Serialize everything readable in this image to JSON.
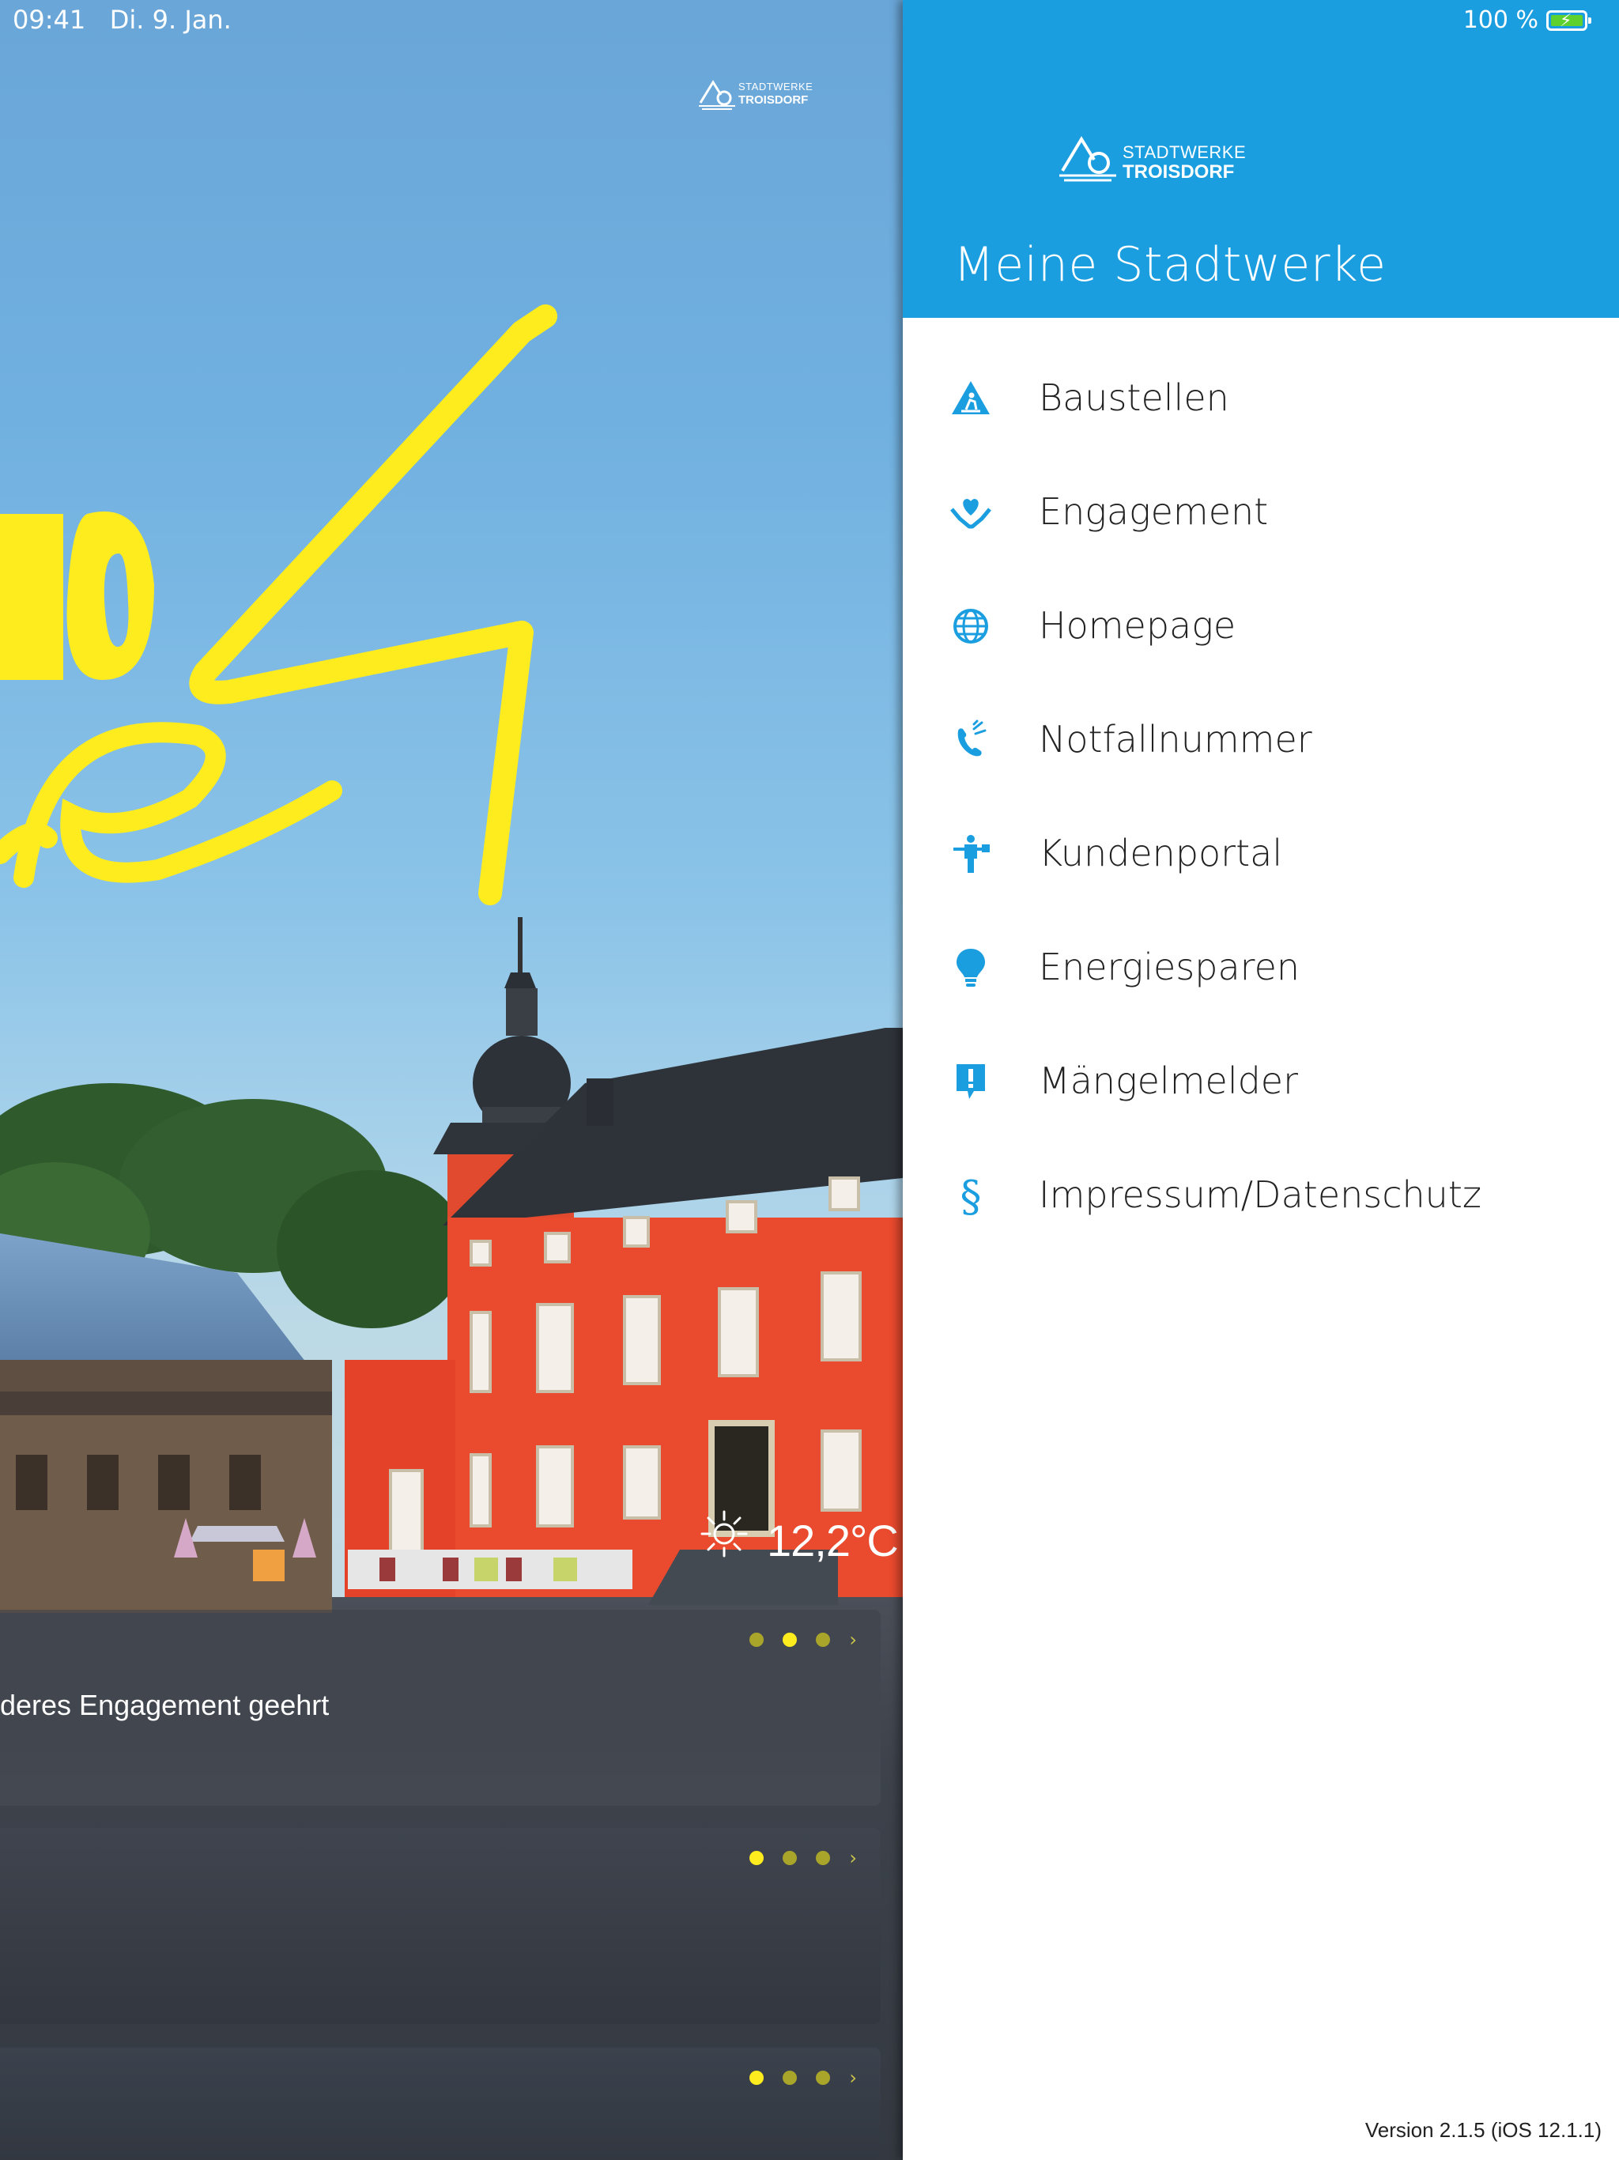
{
  "status_bar": {
    "time": "09:41",
    "date": "Di. 9. Jan.",
    "battery": "100 %"
  },
  "background": {
    "logo_line1": "STADTWERKE",
    "logo_line2": "TROISDORF",
    "weather": {
      "icon": "sun-icon",
      "temperature": "12,2°C"
    },
    "news_cards": [
      {
        "title": "deres Engagement geehrt",
        "dots": 3,
        "active_dot": 1
      },
      {
        "title": "",
        "dots": 3,
        "active_dot": 0
      },
      {
        "title": "",
        "dots": 3,
        "active_dot": 0
      }
    ]
  },
  "drawer": {
    "logo_line1": "STADTWERKE",
    "logo_line2": "TROISDORF",
    "title": "Meine Stadtwerke",
    "items": [
      {
        "label": "Baustellen",
        "icon": "construction-warning-icon"
      },
      {
        "label": "Engagement",
        "icon": "heart-hands-icon"
      },
      {
        "label": "Homepage",
        "icon": "globe-icon"
      },
      {
        "label": "Notfallnummer",
        "icon": "phone-icon"
      },
      {
        "label": "Kundenportal",
        "icon": "customer-person-icon"
      },
      {
        "label": "Energiesparen",
        "icon": "lightbulb-icon"
      },
      {
        "label": "Mängelmelder",
        "icon": "alert-message-icon"
      },
      {
        "label": "Impressum/Datenschutz",
        "icon": "paragraph-icon"
      }
    ],
    "version": "Version 2.1.5 (iOS 12.1.1)"
  },
  "colors": {
    "drawer_header": "#1b9ee0",
    "accent_yellow": "#ffec1e",
    "icon_blue": "#1b9ee0"
  }
}
